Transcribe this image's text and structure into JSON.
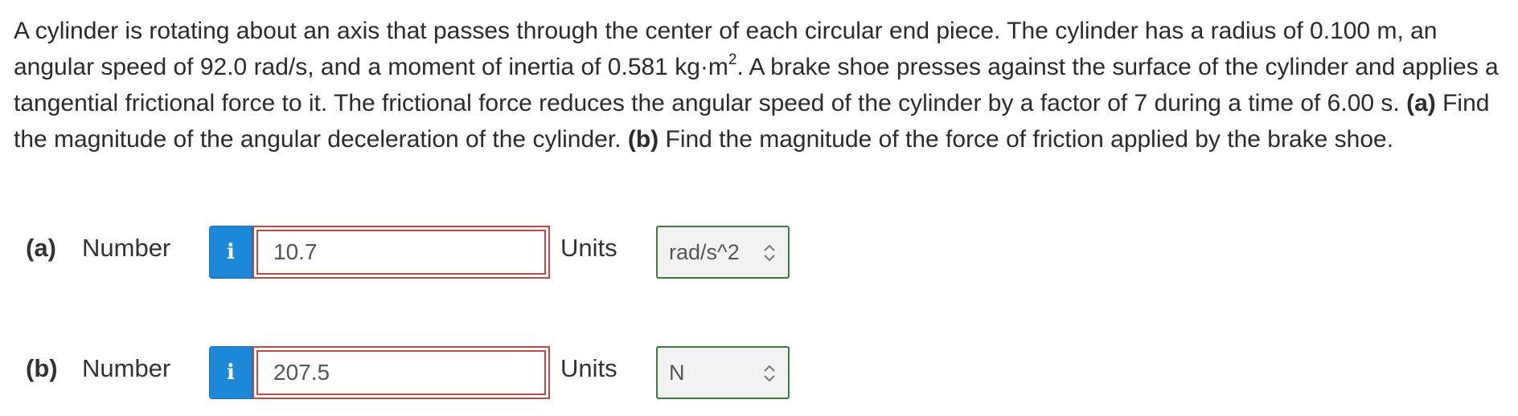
{
  "problem": {
    "text_1": "A cylinder is rotating about an axis that passes through the center of each circular end piece. The cylinder has a radius of 0.100 m, an angular speed of 92.0 rad/s, and a moment of inertia of 0.581 kg·m",
    "sup": "2",
    "text_2": ". A brake shoe presses against the surface of the cylinder and applies a tangential frictional force to it. The frictional force reduces the angular speed of the cylinder by a factor of 7 during a time of 6.00 s. ",
    "part_a_tag": "(a)",
    "part_a_text": " Find the magnitude of the angular deceleration of the cylinder. ",
    "part_b_tag": "(b)",
    "part_b_text": " Find the magnitude of the force of friction applied by the brake shoe."
  },
  "answers": [
    {
      "part": "(a)",
      "number_label": "Number",
      "info_icon": "i",
      "value": "10.7",
      "units_label": "Units",
      "unit": "rad/s^2"
    },
    {
      "part": "(b)",
      "number_label": "Number",
      "info_icon": "i",
      "value": "207.5",
      "units_label": "Units",
      "unit": "N"
    }
  ],
  "colors": {
    "info_button": "#1e88d8",
    "error_border": "#b94a48",
    "unit_border": "#3c7b3c"
  }
}
